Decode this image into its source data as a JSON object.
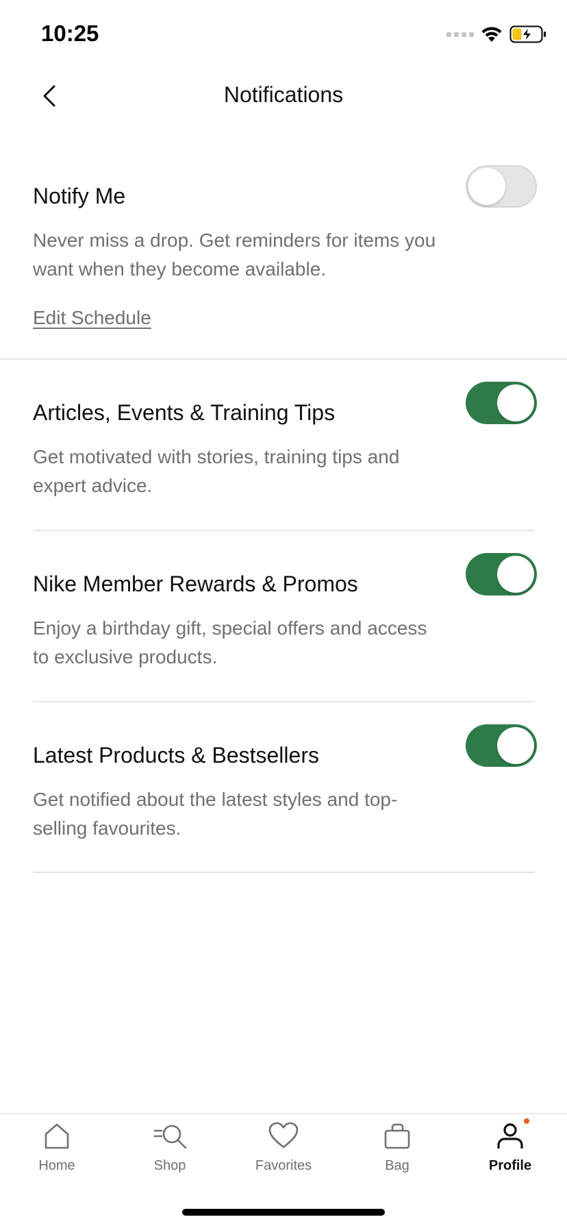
{
  "status_bar": {
    "time": "10:25"
  },
  "header": {
    "title": "Notifications"
  },
  "notify_me": {
    "title": "Notify Me",
    "description": "Never miss a drop. Get reminders for items you want when they become available.",
    "edit_link": "Edit Schedule",
    "enabled": false
  },
  "sections": [
    {
      "title": "Articles, Events & Training Tips",
      "description": "Get motivated with stories, training tips and expert advice.",
      "enabled": true
    },
    {
      "title": "Nike Member Rewards & Promos",
      "description": "Enjoy a birthday gift, special offers and access to exclusive products.",
      "enabled": true
    },
    {
      "title": "Latest Products & Bestsellers",
      "description": "Get notified about the latest styles and top-selling favourites.",
      "enabled": true
    }
  ],
  "tab_bar": {
    "items": [
      {
        "label": "Home",
        "icon": "home-icon"
      },
      {
        "label": "Shop",
        "icon": "shop-search-icon"
      },
      {
        "label": "Favorites",
        "icon": "heart-icon"
      },
      {
        "label": "Bag",
        "icon": "bag-icon"
      },
      {
        "label": "Profile",
        "icon": "profile-icon"
      }
    ],
    "active": "Profile"
  },
  "colors": {
    "toggle_on": "#2e7b49",
    "toggle_off": "#e5e5e5",
    "secondary_text": "#707072",
    "badge": "#f05a22"
  }
}
